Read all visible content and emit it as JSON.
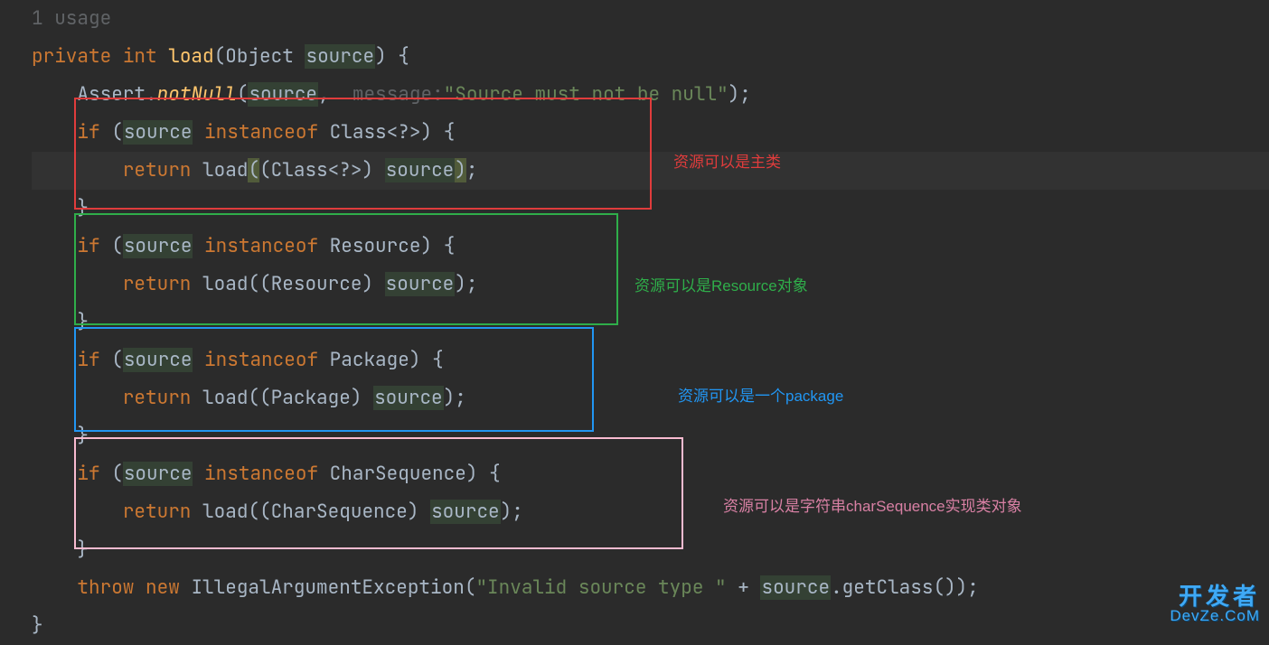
{
  "usage_hint": "1 usage",
  "sig": {
    "mod": "private",
    "ret": "int",
    "name": "load",
    "ptype": "Object",
    "pname": "source"
  },
  "assert": {
    "cls": "Assert",
    "method": "notNull",
    "arg": "source",
    "label": "message:",
    "msg": "\"Source must not be null\""
  },
  "blocks": [
    {
      "check_type": "Class<?>",
      "cast_type": "Class<?>",
      "box_color": "red"
    },
    {
      "check_type": "Resource",
      "cast_type": "Resource",
      "box_color": "green"
    },
    {
      "check_type": "Package",
      "cast_type": "Package",
      "box_color": "blue"
    },
    {
      "check_type": "CharSequence",
      "cast_type": "CharSequence",
      "box_color": "pink"
    }
  ],
  "kw": {
    "if": "if",
    "return": "return",
    "instanceof": "instanceof",
    "throw": "throw",
    "new": "new"
  },
  "throw_line": {
    "ex": "IllegalArgumentException",
    "msg": "\"Invalid source type \"",
    "plus": " + ",
    "var": "source",
    "call": ".getClass());"
  },
  "annotations": {
    "red": "资源可以是主类",
    "green": "资源可以是Resource对象",
    "blue": "资源可以是一个package",
    "pink": "资源可以是字符串charSequence实现类对象"
  },
  "watermark": {
    "top": "开发者",
    "bottom": "DevZe.CoM"
  }
}
